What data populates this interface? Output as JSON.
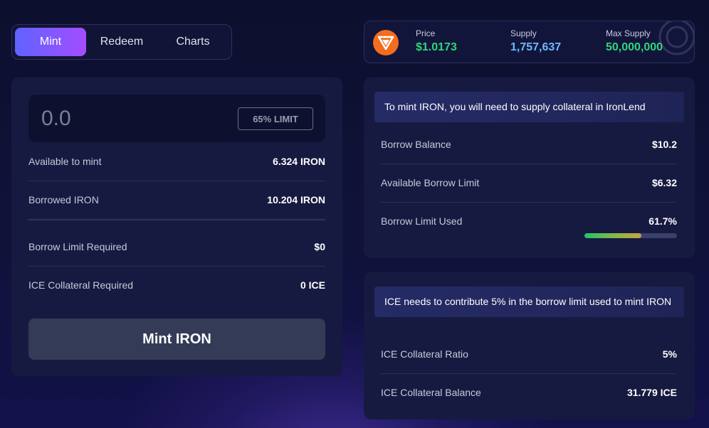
{
  "tabs": [
    {
      "label": "Mint"
    },
    {
      "label": "Redeem"
    },
    {
      "label": "Charts"
    }
  ],
  "stats": {
    "logo_icon": "iron-logo-icon",
    "price": {
      "label": "Price",
      "value": "$1.0173"
    },
    "supply": {
      "label": "Supply",
      "value": "1,757,637"
    },
    "max_supply": {
      "label": "Max Supply",
      "value": "50,000,000"
    }
  },
  "mint_form": {
    "amount_placeholder": "0.0",
    "limit_button": "65% LIMIT",
    "rows": [
      {
        "label": "Available to mint",
        "value": "6.324 IRON"
      },
      {
        "label": "Borrowed IRON",
        "value": "10.204 IRON"
      },
      {
        "label": "Borrow Limit Required",
        "value": "$0"
      },
      {
        "label": "ICE Collateral Required",
        "value": "0 ICE"
      }
    ],
    "submit_label": "Mint IRON"
  },
  "borrow_panel": {
    "notice": "To mint IRON, you will need to supply collateral in IronLend",
    "rows": [
      {
        "label": "Borrow Balance",
        "value": "$10.2"
      },
      {
        "label": "Available Borrow Limit",
        "value": "$6.32"
      },
      {
        "label": "Borrow Limit Used",
        "value": "61.7%"
      }
    ],
    "borrow_limit_used_fraction": 0.617
  },
  "ice_panel": {
    "notice": "ICE needs to contribute 5% in the borrow limit used to mint IRON",
    "rows": [
      {
        "label": "ICE Collateral Ratio",
        "value": "5%"
      },
      {
        "label": "ICE Collateral Balance",
        "value": "31.779 ICE"
      }
    ]
  },
  "colors": {
    "accent_gradient_start": "#5f63ff",
    "accent_gradient_end": "#a44dff",
    "positive": "#2fd67a",
    "supply_blue": "#6fb8ff",
    "logo_orange": "#f26d1e"
  }
}
